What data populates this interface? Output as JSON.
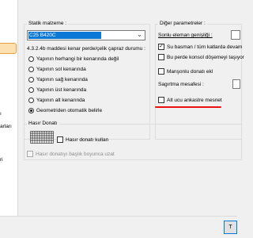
{
  "left": {
    "item_a": "arları",
    "item_b": "ri",
    "item_c": "ı"
  },
  "statik_malzeme": {
    "legend": "Statik malzeme :",
    "selected": "C25 B420C",
    "section_label": "4.3.2.4b maddesi kenar perde/çelik çapraz durumu :",
    "options": [
      {
        "label": "Yapının herhangi bir kenarında değil",
        "checked": false
      },
      {
        "label": "Yapının sol kenarında",
        "checked": false
      },
      {
        "label": "Yapının sağ kenarında",
        "checked": false
      },
      {
        "label": "Yapının üst kenarında",
        "checked": false
      },
      {
        "label": "Yapının alt kenarında",
        "checked": false
      },
      {
        "label": "Geometriden otomatik belirle",
        "checked": true
      }
    ]
  },
  "diger": {
    "legend": "Diğer parametreler :",
    "sonlu_label": "Sonlu eleman genişliği :",
    "su_basman_label": "Su basman / tüm katlarda devam",
    "su_basman_checked": true,
    "konsol_label": "Bu perde konsol döşemeyi taşıyor",
    "konsol_checked": false,
    "mansonlu_label": "Manşonlu donatı ekl",
    "mansonlu_checked": false,
    "sagirtma_label": "Sagırtma mesafesi :",
    "alt_ucu_label": "Alt ucu ankastre mesnet",
    "alt_ucu_checked": false,
    "accent_color": "#ee1111"
  },
  "hasir": {
    "legend": "Hasır Donatı",
    "kullan_label": "Hasır donatı kullan",
    "kullan_checked": false,
    "uzat_label": "Hasır donatıyı başlık boyunca uzat",
    "uzat_checked": false
  },
  "footer": {
    "ok_label": "T"
  },
  "icons": [
    "chevron-down-icon",
    "checkmark-icon",
    "mesh-rebar-icon"
  ]
}
